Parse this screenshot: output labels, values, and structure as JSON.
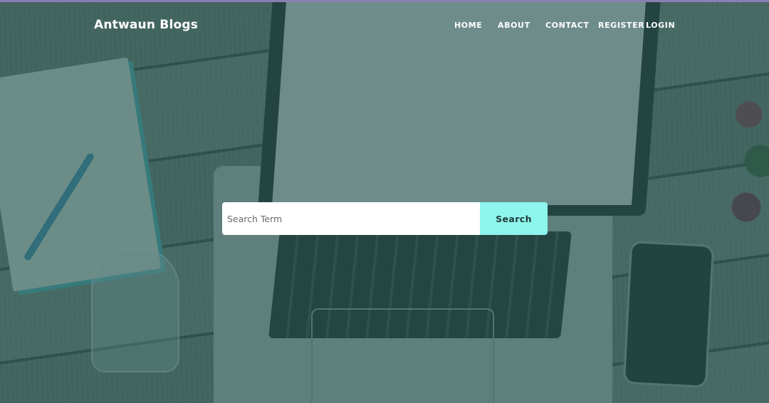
{
  "brand": {
    "title": "Antwaun Blogs"
  },
  "nav": {
    "items": [
      {
        "label": "HOME"
      },
      {
        "label": "ABOUT"
      },
      {
        "label": "CONTACT"
      },
      {
        "label": "REGISTER"
      },
      {
        "label": "LOGIN"
      }
    ]
  },
  "search": {
    "placeholder": "Search Term",
    "value": "",
    "button_label": "Search"
  },
  "colors": {
    "overlay": "#285856",
    "search_button": "#8ef5ec",
    "nav_text": "#ffffff",
    "top_border": "#8a7fb3"
  }
}
